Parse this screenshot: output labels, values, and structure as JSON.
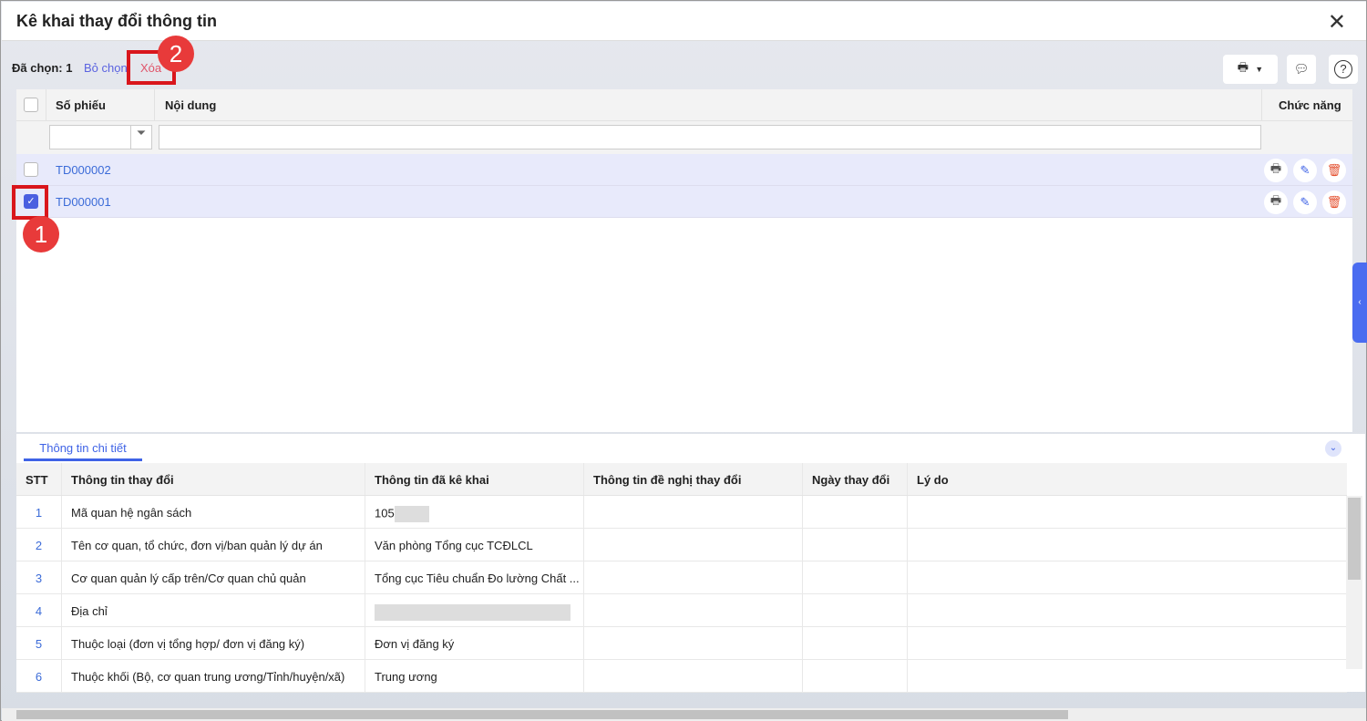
{
  "title": "Kê khai thay đổi thông tin",
  "toolbar": {
    "selected_label": "Đã chọn: 1",
    "deselect": "Bỏ chọn",
    "delete": "Xóa"
  },
  "grid": {
    "columns": [
      "Số phiếu",
      "Nội dung",
      "Chức năng"
    ],
    "rows": [
      {
        "code": "TD000002",
        "checked": false
      },
      {
        "code": "TD000001",
        "checked": true
      }
    ]
  },
  "detail": {
    "tab": "Thông tin chi tiết",
    "columns": [
      "STT",
      "Thông tin thay đổi",
      "Thông tin đã kê khai",
      "Thông tin đề nghị thay đổi",
      "Ngày thay đổi",
      "Lý do"
    ],
    "rows": [
      {
        "stt": "1",
        "field": "Mã quan hệ ngân sách",
        "declared": "105"
      },
      {
        "stt": "2",
        "field": "Tên cơ quan, tổ chức, đơn vị/ban quản lý dự án",
        "declared": "Văn phòng Tổng cục TCĐLCL"
      },
      {
        "stt": "3",
        "field": "Cơ quan quản lý cấp trên/Cơ quan chủ quản",
        "declared": "Tổng cục Tiêu chuẩn Đo lường Chất ..."
      },
      {
        "stt": "4",
        "field": "Địa chỉ",
        "declared": ""
      },
      {
        "stt": "5",
        "field": "Thuộc loại (đơn vị tổng hợp/ đơn vị đăng ký)",
        "declared": "Đơn vị đăng ký"
      },
      {
        "stt": "6",
        "field": "Thuộc khối (Bộ, cơ quan trung ương/Tỉnh/huyện/xã)",
        "declared": "Trung ương"
      }
    ]
  },
  "annotations": [
    "1",
    "2"
  ],
  "colors": {
    "accent": "#3f63e6",
    "danger": "#e83a3a"
  }
}
